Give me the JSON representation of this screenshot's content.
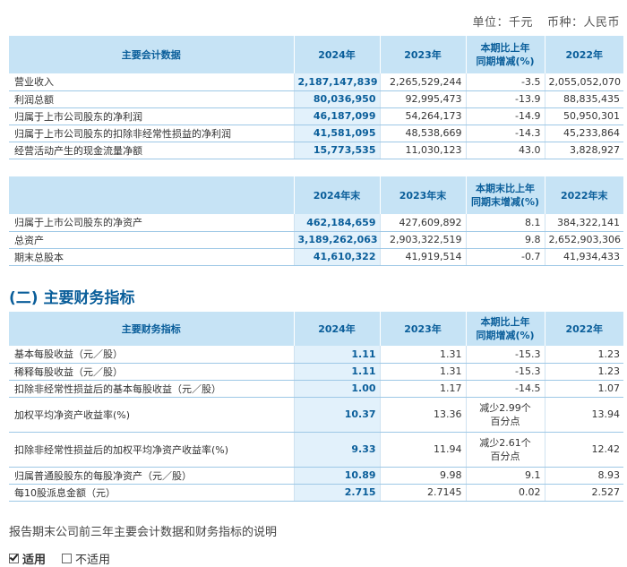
{
  "unit": {
    "unit_label": "单位：千元",
    "currency_label": "币种：人民币"
  },
  "table1": {
    "headers": [
      "主要会计数据",
      "2024年",
      "2023年",
      "本期比上年\n同期增减(%)",
      "2022年"
    ],
    "rows": [
      [
        "营业收入",
        "2,187,147,839",
        "2,265,529,244",
        "-3.5",
        "2,055,052,070"
      ],
      [
        "利润总额",
        "80,036,950",
        "92,995,473",
        "-13.9",
        "88,835,435"
      ],
      [
        "归属于上市公司股东的净利润",
        "46,187,099",
        "54,264,173",
        "-14.9",
        "50,950,301"
      ],
      [
        "归属于上市公司股东的扣除非经常性损益的净利润",
        "41,581,095",
        "48,538,669",
        "-14.3",
        "45,233,864"
      ],
      [
        "经营活动产生的现金流量净额",
        "15,773,535",
        "11,030,123",
        "43.0",
        "3,828,927"
      ]
    ]
  },
  "table2": {
    "headers": [
      "",
      "2024年末",
      "2023年末",
      "本期末比上年\n同期末增减(%)",
      "2022年末"
    ],
    "rows": [
      [
        "归属于上市公司股东的净资产",
        "462,184,659",
        "427,609,892",
        "8.1",
        "384,322,141"
      ],
      [
        "总资产",
        "3,189,262,063",
        "2,903,322,519",
        "9.8",
        "2,652,903,306"
      ],
      [
        "期末总股本",
        "41,610,322",
        "41,919,514",
        "-0.7",
        "41,934,433"
      ]
    ]
  },
  "section_title": "(二) 主要财务指标",
  "table3": {
    "headers": [
      "主要财务指标",
      "2024年",
      "2023年",
      "本期比上年\n同期增减(%)",
      "2022年"
    ],
    "rows": [
      [
        "基本每股收益（元／股）",
        "1.11",
        "1.31",
        "-15.3",
        "1.23"
      ],
      [
        "稀释每股收益（元／股）",
        "1.11",
        "1.31",
        "-15.3",
        "1.23"
      ],
      [
        "扣除非经常性损益后的基本每股收益（元／股）",
        "1.00",
        "1.17",
        "-14.5",
        "1.07"
      ],
      [
        "加权平均净资产收益率(%)",
        "10.37",
        "13.36",
        "减少2.99个\n百分点",
        "13.94"
      ],
      [
        "扣除非经常性损益后的加权平均净资产收益率(%)",
        "9.33",
        "11.94",
        "减少2.61个\n百分点",
        "12.42"
      ],
      [
        "归属普通股股东的每股净资产（元／股）",
        "10.89",
        "9.98",
        "9.1",
        "8.93"
      ],
      [
        "每10股派息金额（元）",
        "2.715",
        "2.7145",
        "0.02",
        "2.527"
      ]
    ]
  },
  "note": "报告期末公司前三年主要会计数据和财务指标的说明",
  "options": {
    "applicable": "适用",
    "not_applicable": "不适用"
  }
}
